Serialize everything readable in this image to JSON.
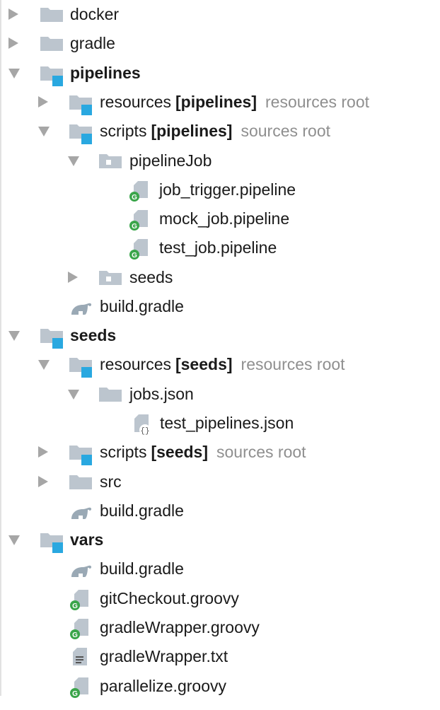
{
  "colors": {
    "folder": "#bcc5ce",
    "module_marker": "#29a8e0",
    "arrow": "#a6a6a6",
    "hint": "#8f8f8f",
    "groovy_badge": "#3aa54a",
    "gradle_icon": "#9aa9b5"
  },
  "tree": [
    {
      "label": "docker",
      "expanded": false,
      "icon": "folder-icon"
    },
    {
      "label": "gradle",
      "expanded": false,
      "icon": "folder-icon"
    },
    {
      "label": "pipelines",
      "expanded": true,
      "icon": "module-folder-icon"
    },
    {
      "label": "resources",
      "tag": "[pipelines]",
      "hint": "resources root",
      "expanded": false,
      "icon": "module-folder-icon"
    },
    {
      "label": "scripts",
      "tag": "[pipelines]",
      "hint": "sources root",
      "expanded": true,
      "icon": "module-folder-icon"
    },
    {
      "label": "pipelineJob",
      "expanded": true,
      "icon": "package-folder-icon"
    },
    {
      "label": "job_trigger.pipeline",
      "icon": "groovy-file-icon"
    },
    {
      "label": "mock_job.pipeline",
      "icon": "groovy-file-icon"
    },
    {
      "label": "test_job.pipeline",
      "icon": "groovy-file-icon"
    },
    {
      "label": "seeds",
      "expanded": false,
      "icon": "package-folder-icon"
    },
    {
      "label": "build.gradle",
      "icon": "gradle-icon"
    },
    {
      "label": "seeds",
      "expanded": true,
      "icon": "module-folder-icon"
    },
    {
      "label": "resources",
      "tag": "[seeds]",
      "hint": "resources root",
      "expanded": true,
      "icon": "module-folder-icon"
    },
    {
      "label": "jobs.json",
      "expanded": true,
      "icon": "folder-icon"
    },
    {
      "label": "test_pipelines.json",
      "icon": "json-file-icon"
    },
    {
      "label": "scripts",
      "tag": "[seeds]",
      "hint": "sources root",
      "expanded": false,
      "icon": "module-folder-icon"
    },
    {
      "label": "src",
      "expanded": false,
      "icon": "folder-icon"
    },
    {
      "label": "build.gradle",
      "icon": "gradle-icon"
    },
    {
      "label": "vars",
      "expanded": true,
      "icon": "module-folder-icon"
    },
    {
      "label": "build.gradle",
      "icon": "gradle-icon"
    },
    {
      "label": "gitCheckout.groovy",
      "icon": "groovy-file-icon"
    },
    {
      "label": "gradleWrapper.groovy",
      "icon": "groovy-file-icon"
    },
    {
      "label": "gradleWrapper.txt",
      "icon": "text-file-icon"
    },
    {
      "label": "parallelize.groovy",
      "icon": "groovy-file-icon"
    }
  ]
}
